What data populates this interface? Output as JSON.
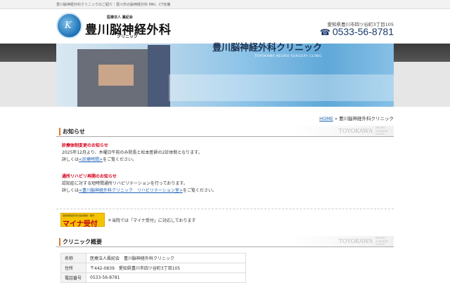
{
  "top_strip": "豊川脳神経外科クリニックのご紹介｜豊川市の脳神経外科 MRI、CT完備",
  "header": {
    "logo_mark": "K",
    "corp": "医療法人 鳳紀会",
    "name": "豊川脳神経外科",
    "sub": "クリニック",
    "address": "愛知県豊川市四ツ谷町3丁目105",
    "phone": "0533-56-8781",
    "phone_icon": "telephone-icon"
  },
  "banner": {
    "title": "豊川脳神経外科クリニック",
    "subtitle": "TOYOKAWA NEURO SURGERY CLINIC"
  },
  "breadcrumb": {
    "home": "HOME",
    "sep": "»",
    "current": "豊川脳神経外科クリニック"
  },
  "news": {
    "heading": "お知らせ",
    "watermark": "TOYOKAWA",
    "watermark_small": "NEURO SURGERY CLINIC",
    "items": [
      {
        "title": "診療体制変更のお知らせ",
        "line1": "2025年12月より、木曜日午前のみ院長と松本医師の2診体制となります。",
        "pre": "詳しくは",
        "link": "<診療時間>",
        "post": "をご覧ください。"
      },
      {
        "title": "通所リハビリ再開のお知らせ",
        "line1": "認知症に対する短時間通所リハビリテーションを行っております。",
        "pre": "詳しくは",
        "link": "<豊川脳神経外科クリニック　リハビリテーション室>",
        "post": "をご覧ください。"
      }
    ]
  },
  "myna": {
    "badge_small": "健康保険証利用の医療機関・薬局",
    "badge": "マイナ受付",
    "text": "＊当院では「マイナ受付」に対応しております"
  },
  "overview": {
    "heading": "クリニック概要",
    "watermark": "TOYOKAWA",
    "watermark_small": "NEURO SURGERY CLINIC",
    "rows": [
      {
        "k": "名称",
        "v": "医療法人鳳紀会　豊川脳神経外科クリニック"
      },
      {
        "k": "住所",
        "v": "〒442-0839　愛知県豊川市四ツ谷町3丁目105"
      },
      {
        "k": "電話番号",
        "v": "0533-56-8781"
      }
    ]
  }
}
